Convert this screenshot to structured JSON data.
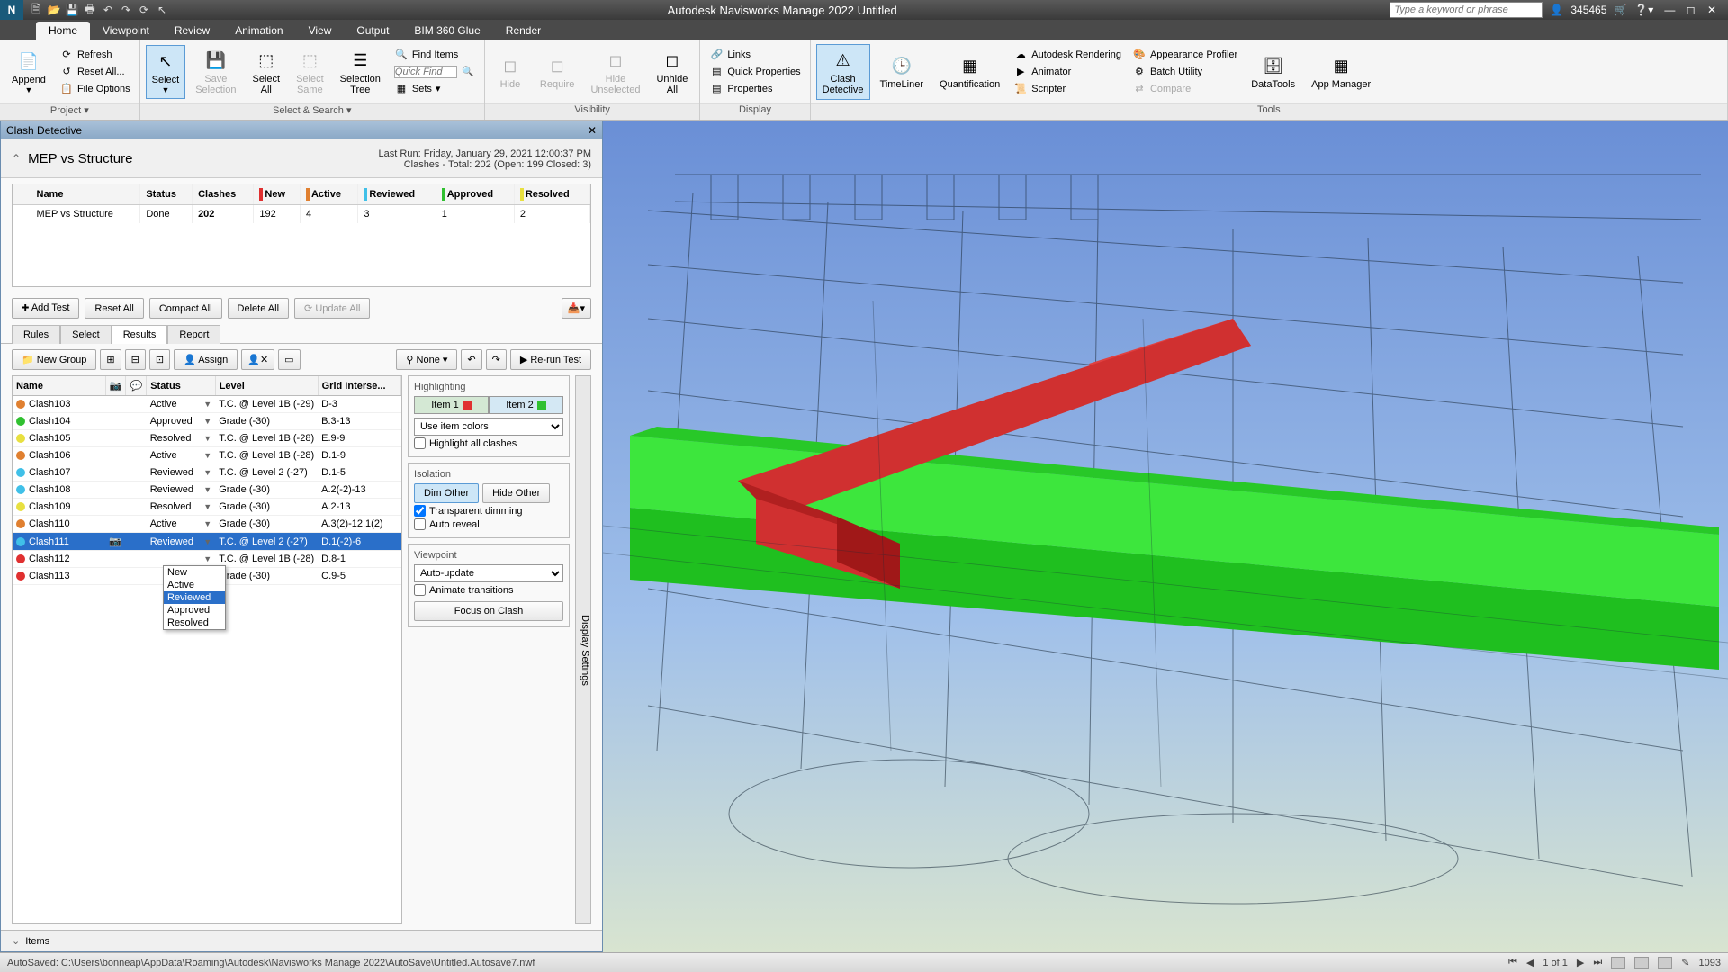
{
  "app": {
    "title": "Autodesk Navisworks Manage 2022   Untitled",
    "search_placeholder": "Type a keyword or phrase",
    "user_id": "345465"
  },
  "tabs": [
    "Home",
    "Viewpoint",
    "Review",
    "Animation",
    "View",
    "Output",
    "BIM 360 Glue",
    "Render"
  ],
  "active_tab": "Home",
  "ribbon": {
    "project": {
      "label": "Project ▾",
      "append": "Append",
      "refresh": "Refresh",
      "reset_all": "Reset All...",
      "file_options": "File Options"
    },
    "select_search": {
      "label": "Select & Search ▾",
      "select": "Select",
      "save_sel": "Save\nSelection",
      "select_all": "Select\nAll",
      "select_same": "Select\nSame",
      "sel_tree": "Selection\nTree",
      "find_items": "Find Items",
      "quick_find": "Quick Find",
      "sets": "Sets"
    },
    "visibility": {
      "label": "Visibility",
      "hide": "Hide",
      "require": "Require",
      "hide_unsel": "Hide\nUnselected",
      "unhide": "Unhide\nAll"
    },
    "display": {
      "label": "Display",
      "links": "Links",
      "quick_props": "Quick Properties",
      "properties": "Properties"
    },
    "tools": {
      "label": "Tools",
      "clash": "Clash\nDetective",
      "timeliner": "TimeLiner",
      "quant": "Quantification",
      "rendering": "Autodesk Rendering",
      "animator": "Animator",
      "scripter": "Scripter",
      "appear": "Appearance Profiler",
      "batch": "Batch Utility",
      "compare": "Compare",
      "datatools": "DataTools",
      "appmgr": "App Manager"
    }
  },
  "clash": {
    "panel_title": "Clash Detective",
    "test_name": "MEP vs Structure",
    "last_run_label": "Last Run:",
    "last_run": "Friday, January 29, 2021 12:00:37 PM",
    "summary": "Clashes - Total: 202 (Open: 199 Closed: 3)",
    "table": {
      "headers": {
        "name": "Name",
        "status": "Status",
        "clashes": "Clashes",
        "new": "New",
        "active": "Active",
        "reviewed": "Reviewed",
        "approved": "Approved",
        "resolved": "Resolved"
      },
      "row": {
        "name": "MEP vs Structure",
        "status": "Done",
        "clashes": "202",
        "new": "192",
        "active": "4",
        "reviewed": "3",
        "approved": "1",
        "resolved": "2"
      }
    },
    "buttons": {
      "add": "Add Test",
      "reset": "Reset All",
      "compact": "Compact All",
      "delete": "Delete All",
      "update": "Update All"
    },
    "subtabs": [
      "Rules",
      "Select",
      "Results",
      "Report"
    ],
    "active_subtab": "Results",
    "toolbar": {
      "new_group": "New Group",
      "assign": "Assign",
      "none": "None",
      "rerun": "Re-run Test"
    },
    "cols": {
      "name": "Name",
      "status": "Status",
      "level": "Level",
      "grid": "Grid Interse..."
    },
    "rows": [
      {
        "c": "#e08030",
        "name": "Clash103",
        "status": "Active",
        "level": "T.C. @ Level 1B (-29)",
        "grid": "D-3"
      },
      {
        "c": "#30c030",
        "name": "Clash104",
        "status": "Approved",
        "level": "Grade (-30)",
        "grid": "B.3-13"
      },
      {
        "c": "#e8e040",
        "name": "Clash105",
        "status": "Resolved",
        "level": "T.C. @ Level 1B (-28)",
        "grid": "E.9-9"
      },
      {
        "c": "#e08030",
        "name": "Clash106",
        "status": "Active",
        "level": "T.C. @ Level 1B (-28)",
        "grid": "D.1-9"
      },
      {
        "c": "#40c0e8",
        "name": "Clash107",
        "status": "Reviewed",
        "level": "T.C. @ Level 2 (-27)",
        "grid": "D.1-5"
      },
      {
        "c": "#40c0e8",
        "name": "Clash108",
        "status": "Reviewed",
        "level": "Grade (-30)",
        "grid": "A.2(-2)-13"
      },
      {
        "c": "#e8e040",
        "name": "Clash109",
        "status": "Resolved",
        "level": "Grade (-30)",
        "grid": "A.2-13"
      },
      {
        "c": "#e08030",
        "name": "Clash110",
        "status": "Active",
        "level": "Grade (-30)",
        "grid": "A.3(2)-12.1(2)"
      },
      {
        "c": "#40c0e8",
        "name": "Clash111",
        "status": "Reviewed",
        "level": "T.C. @ Level 2 (-27)",
        "grid": "D.1(-2)-6",
        "sel": true,
        "cam": true
      },
      {
        "c": "#e03030",
        "name": "Clash112",
        "status": "",
        "level": "T.C. @ Level 1B (-28)",
        "grid": "D.8-1"
      },
      {
        "c": "#e03030",
        "name": "Clash113",
        "status": "",
        "level": "Grade (-30)",
        "grid": "C.9-5"
      }
    ],
    "status_menu": [
      "New",
      "Active",
      "Reviewed",
      "Approved",
      "Resolved"
    ],
    "status_menu_hl": "Reviewed",
    "side": {
      "display_settings": "Display Settings",
      "highlighting": "Highlighting",
      "item1": "Item 1",
      "item2": "Item 2",
      "use_colors": "Use item colors",
      "hl_all": "Highlight all clashes",
      "isolation": "Isolation",
      "dim": "Dim Other",
      "hide": "Hide Other",
      "transp": "Transparent dimming",
      "auto_reveal": "Auto reveal",
      "viewpoint": "Viewpoint",
      "auto_update": "Auto-update",
      "animate": "Animate transitions",
      "focus": "Focus on Clash"
    },
    "items_label": "Items"
  },
  "status": {
    "autosave": "AutoSaved: C:\\Users\\bonneap\\AppData\\Roaming\\Autodesk\\Navisworks Manage 2022\\AutoSave\\Untitled.Autosave7.nwf",
    "page": "1 of 1",
    "mem": "1093"
  },
  "colors": {
    "item1": "#e03030",
    "item2": "#30c030"
  }
}
